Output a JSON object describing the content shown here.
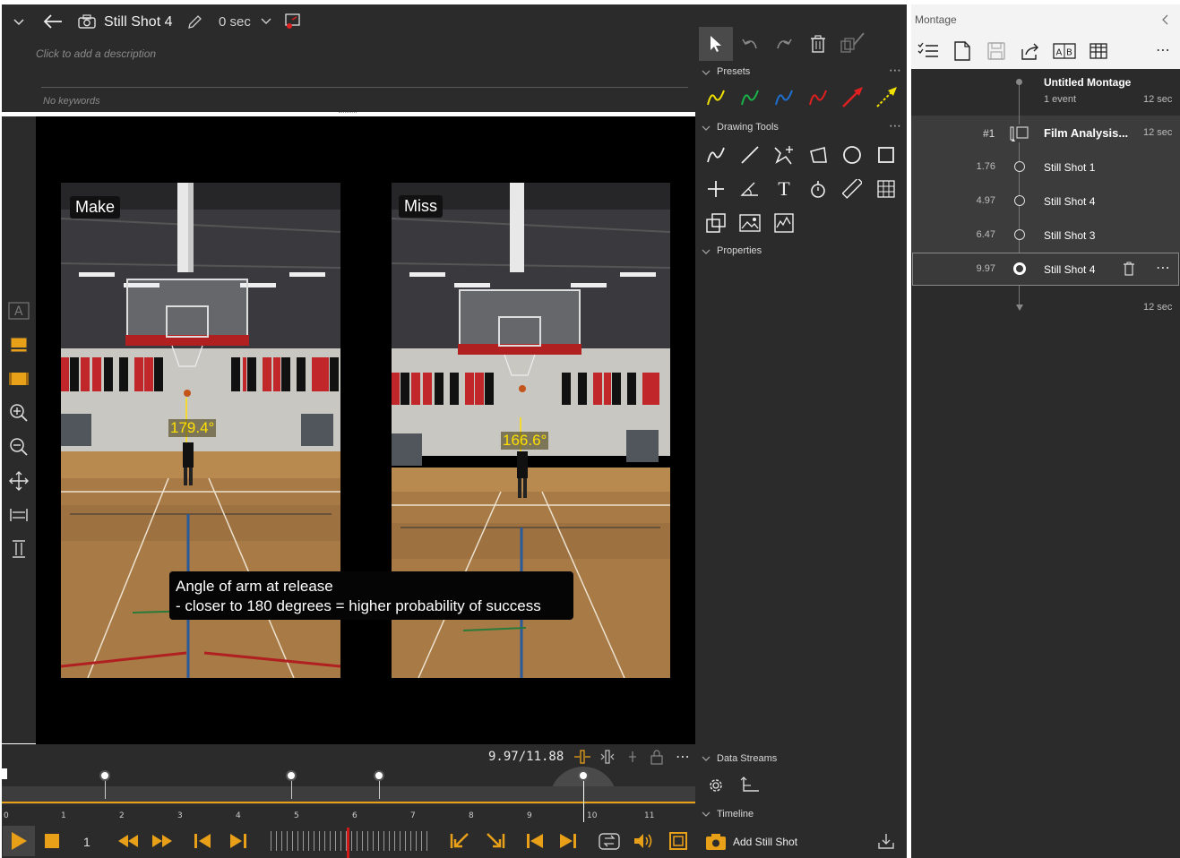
{
  "header": {
    "title": "Still Shot 4",
    "duration": "0 sec",
    "description_placeholder": "Click to add a description",
    "keywords_placeholder": "No keywords"
  },
  "video": {
    "left_label": "Make",
    "right_label": "Miss",
    "left_angle": "179.4°",
    "right_angle": "166.6°",
    "caption_line1": "Angle of arm at release",
    "caption_line2": "- closer to 180 degrees = higher probability of success"
  },
  "timeline": {
    "timecode": "9.97/11.88",
    "ticks": [
      "0",
      "1",
      "2",
      "3",
      "4",
      "5",
      "6",
      "7",
      "8",
      "9",
      "10",
      "11"
    ],
    "speed": "1",
    "add_still_shot": "Add Still Shot"
  },
  "tools": {
    "presets_label": "Presets",
    "drawing_tools_label": "Drawing Tools",
    "properties_label": "Properties",
    "data_streams_label": "Data Streams",
    "timeline_label": "Timeline"
  },
  "montage": {
    "panel_title": "Montage",
    "name": "Untitled Montage",
    "events": "1 event",
    "total_duration": "12 sec",
    "group_number": "#1",
    "group_name": "Film Analysis...",
    "group_duration": "12 sec",
    "items": [
      {
        "time": "1.76",
        "name": "Still Shot 1"
      },
      {
        "time": "4.97",
        "name": "Still Shot 4"
      },
      {
        "time": "6.47",
        "name": "Still Shot 3"
      },
      {
        "time": "9.97",
        "name": "Still Shot 4"
      }
    ],
    "end_duration": "12 sec"
  },
  "colors": {
    "accent": "#e9a019",
    "panel": "#2b2b2b",
    "preset_yellow": "#f0e000",
    "preset_green": "#19b34a",
    "preset_blue": "#1e6fd0",
    "preset_red": "#e02020"
  }
}
